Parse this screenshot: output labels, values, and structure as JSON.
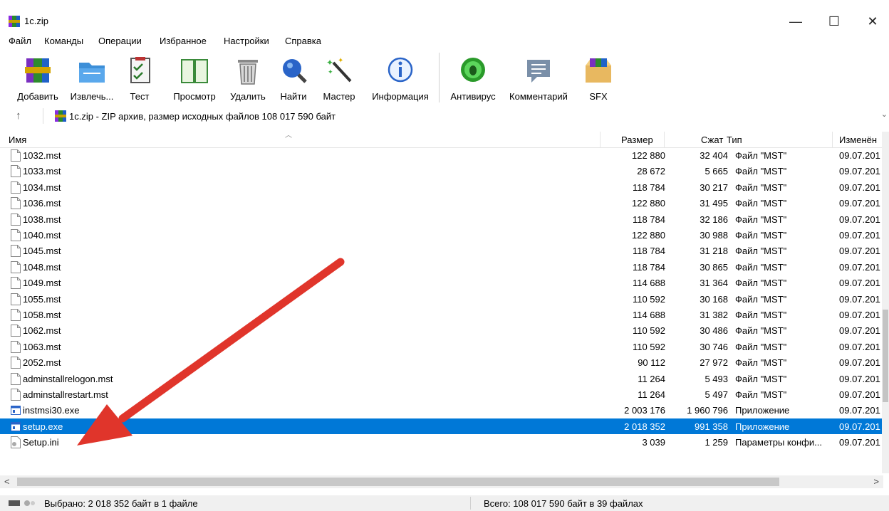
{
  "window": {
    "title": "1c.zip",
    "minimize": "—",
    "maximize": "☐",
    "close": "✕"
  },
  "menu": [
    "Файл",
    "Команды",
    "Операции",
    "Избранное",
    "Настройки",
    "Справка"
  ],
  "toolbar": [
    {
      "label": "Добавить",
      "icon": "add-archive-icon"
    },
    {
      "label": "Извлечь...",
      "icon": "extract-icon"
    },
    {
      "label": "Тест",
      "icon": "test-icon"
    },
    {
      "label": "Просмотр",
      "icon": "view-icon"
    },
    {
      "label": "Удалить",
      "icon": "delete-icon"
    },
    {
      "label": "Найти",
      "icon": "find-icon"
    },
    {
      "label": "Мастер",
      "icon": "wizard-icon"
    },
    {
      "label": "Информация",
      "icon": "info-icon"
    },
    {
      "label": "Антивирус",
      "icon": "antivirus-icon"
    },
    {
      "label": "Комментарий",
      "icon": "comment-icon"
    },
    {
      "label": "SFX",
      "icon": "sfx-icon"
    }
  ],
  "address": {
    "text": "1c.zip - ZIP архив, размер исходных файлов 108 017 590 байт"
  },
  "columns": {
    "name": "Имя",
    "size": "Размер",
    "packed": "Сжат",
    "type": "Тип",
    "modified": "Изменён"
  },
  "files": [
    {
      "name": "1032.mst",
      "size": "122 880",
      "packed": "32 404",
      "type": "Файл \"MST\"",
      "modified": "09.07.201",
      "kind": "doc"
    },
    {
      "name": "1033.mst",
      "size": "28 672",
      "packed": "5 665",
      "type": "Файл \"MST\"",
      "modified": "09.07.201",
      "kind": "doc"
    },
    {
      "name": "1034.mst",
      "size": "118 784",
      "packed": "30 217",
      "type": "Файл \"MST\"",
      "modified": "09.07.201",
      "kind": "doc"
    },
    {
      "name": "1036.mst",
      "size": "122 880",
      "packed": "31 495",
      "type": "Файл \"MST\"",
      "modified": "09.07.201",
      "kind": "doc"
    },
    {
      "name": "1038.mst",
      "size": "118 784",
      "packed": "32 186",
      "type": "Файл \"MST\"",
      "modified": "09.07.201",
      "kind": "doc"
    },
    {
      "name": "1040.mst",
      "size": "122 880",
      "packed": "30 988",
      "type": "Файл \"MST\"",
      "modified": "09.07.201",
      "kind": "doc"
    },
    {
      "name": "1045.mst",
      "size": "118 784",
      "packed": "31 218",
      "type": "Файл \"MST\"",
      "modified": "09.07.201",
      "kind": "doc"
    },
    {
      "name": "1048.mst",
      "size": "118 784",
      "packed": "30 865",
      "type": "Файл \"MST\"",
      "modified": "09.07.201",
      "kind": "doc"
    },
    {
      "name": "1049.mst",
      "size": "114 688",
      "packed": "31 364",
      "type": "Файл \"MST\"",
      "modified": "09.07.201",
      "kind": "doc"
    },
    {
      "name": "1055.mst",
      "size": "110 592",
      "packed": "30 168",
      "type": "Файл \"MST\"",
      "modified": "09.07.201",
      "kind": "doc"
    },
    {
      "name": "1058.mst",
      "size": "114 688",
      "packed": "31 382",
      "type": "Файл \"MST\"",
      "modified": "09.07.201",
      "kind": "doc"
    },
    {
      "name": "1062.mst",
      "size": "110 592",
      "packed": "30 486",
      "type": "Файл \"MST\"",
      "modified": "09.07.201",
      "kind": "doc"
    },
    {
      "name": "1063.mst",
      "size": "110 592",
      "packed": "30 746",
      "type": "Файл \"MST\"",
      "modified": "09.07.201",
      "kind": "doc"
    },
    {
      "name": "2052.mst",
      "size": "90 112",
      "packed": "27 972",
      "type": "Файл \"MST\"",
      "modified": "09.07.201",
      "kind": "doc"
    },
    {
      "name": "adminstallrelogon.mst",
      "size": "11 264",
      "packed": "5 493",
      "type": "Файл \"MST\"",
      "modified": "09.07.201",
      "kind": "doc"
    },
    {
      "name": "adminstallrestart.mst",
      "size": "11 264",
      "packed": "5 497",
      "type": "Файл \"MST\"",
      "modified": "09.07.201",
      "kind": "doc"
    },
    {
      "name": "instmsi30.exe",
      "size": "2 003 176",
      "packed": "1 960 796",
      "type": "Приложение",
      "modified": "09.07.201",
      "kind": "exe"
    },
    {
      "name": "setup.exe",
      "size": "2 018 352",
      "packed": "991 358",
      "type": "Приложение",
      "modified": "09.07.201",
      "kind": "exe",
      "selected": true
    },
    {
      "name": "Setup.ini",
      "size": "3 039",
      "packed": "1 259",
      "type": "Параметры конфи...",
      "modified": "09.07.201",
      "kind": "ini"
    }
  ],
  "status": {
    "selected": "Выбрано: 2 018 352 байт в 1 файле",
    "total": "Всего: 108 017 590 байт в 39 файлах"
  },
  "colors": {
    "selection": "#0078d7",
    "arrow": "#e0352b"
  }
}
